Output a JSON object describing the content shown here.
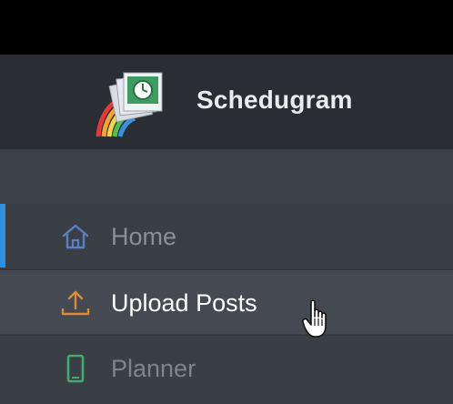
{
  "app": {
    "name": "Schedugram",
    "logo_icon": "schedugram-logo-icon"
  },
  "sidebar": {
    "items": [
      {
        "id": "home",
        "label": "Home",
        "icon": "home-icon",
        "icon_color": "#5a7fc4",
        "active": true
      },
      {
        "id": "upload",
        "label": "Upload Posts",
        "icon": "upload-icon",
        "icon_color": "#d98a3a",
        "hovered": true
      },
      {
        "id": "planner",
        "label": "Planner",
        "icon": "phone-icon",
        "icon_color": "#3fae6a"
      }
    ]
  },
  "colors": {
    "accent": "#2f8fe0",
    "brand_bar": "#2a2d33",
    "sidebar_bg": "#3a3e45",
    "hover_bg": "#454a52"
  },
  "cursor": {
    "icon": "hand-pointer-icon"
  }
}
